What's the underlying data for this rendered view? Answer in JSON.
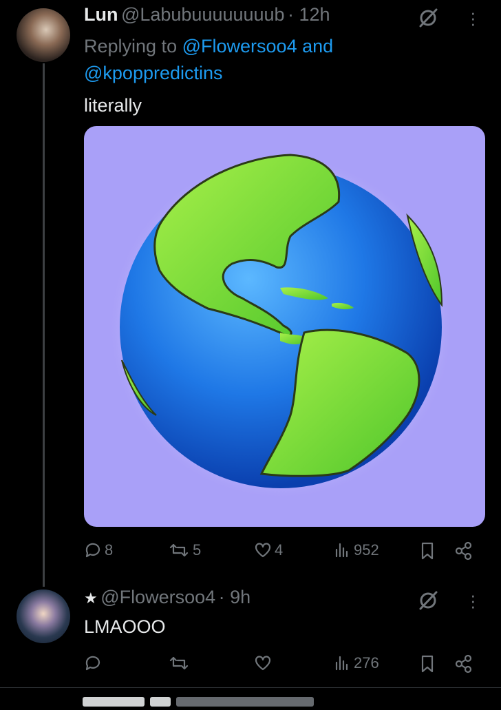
{
  "tweet1": {
    "display_name": "Lun",
    "handle": "@Labubuuuuuuuub",
    "time": "· 12h",
    "replying_prefix": "Replying to",
    "replying_user1": "@Flowersoo4",
    "replying_and": "and",
    "replying_user2": "@kpoppredictins",
    "text": "literally",
    "media_icon": "earth-globe-americas",
    "stats": {
      "replies": "8",
      "reposts": "5",
      "likes": "4",
      "views": "952"
    }
  },
  "tweet2": {
    "badge": "★",
    "handle": "@Flowersoo4",
    "time": "· 9h",
    "text": "LMAOOO",
    "stats": {
      "replies": "",
      "reposts": "",
      "likes": "",
      "views": "276"
    }
  },
  "colors": {
    "background": "#000000",
    "link": "#1d9bf0",
    "muted": "#71767b",
    "media_bg": "#a9a0f8"
  }
}
